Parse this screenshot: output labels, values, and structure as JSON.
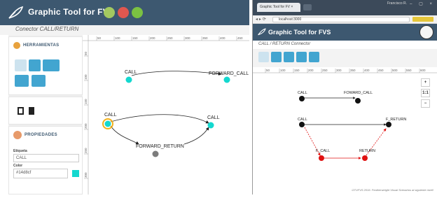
{
  "left_app": {
    "title": "Graphic Tool for FVS",
    "subtitle": "Conector CALL/RETURN",
    "tools_panel": {
      "heading": "HERRAMIENTAS"
    },
    "properties_panel": {
      "heading": "PROPIEDADES",
      "label_field": {
        "label": "Etiqueta",
        "value": "CALL"
      },
      "color_field": {
        "label": "Color",
        "value": "#14d8cf"
      }
    },
    "ruler_top": [
      "50",
      "100",
      "150",
      "200",
      "250",
      "300",
      "350",
      "400",
      "450"
    ],
    "ruler_left": [
      "50",
      "100",
      "150",
      "200",
      "250",
      "300"
    ],
    "nodes": {
      "call_top": "CALL",
      "forward_call": "FORWARD_CALL",
      "call_bottom": "CALL",
      "call_right": "CALL",
      "forward_return": "FORWARD_RETURN"
    },
    "colors": {
      "header": "#3d5870",
      "node_cyan": "#14d8cf",
      "node_gray": "#7c7c7c",
      "accent_blue": "#42a5d0"
    }
  },
  "right_browser": {
    "window_user": "Francisco R.",
    "window_buttons": "– ▢ ×",
    "tab_title": "Graphic Tool for FV ×",
    "url": "localhost:3000",
    "app_title": "Graphic Tool for FVS",
    "subtitle": "CALL / RETURN Connector",
    "ruler_top": [
      "50",
      "100",
      "150",
      "200",
      "250",
      "300",
      "350",
      "400",
      "450",
      "500",
      "550",
      "600"
    ],
    "zoom_label": "1:1",
    "nodes": {
      "call_top": "CALL",
      "fowward_call": "FOWARD_CALL",
      "call_bottom": "CALL",
      "f_return": "F_RETURN",
      "f_call": "F_CALL",
      "return": "RETURN"
    },
    "footer": "GTUFVS 2016. Featherweight Visual Scenarios at siguiente nivel!",
    "colors": {
      "node_black": "#111111",
      "node_red": "#e01010"
    }
  }
}
